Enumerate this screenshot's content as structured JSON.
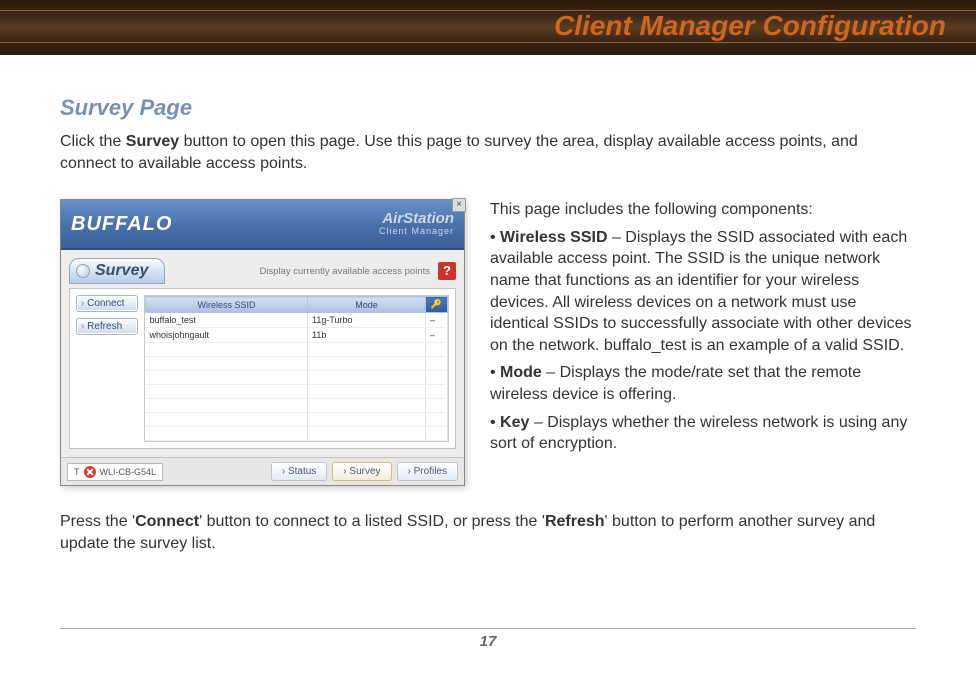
{
  "header": {
    "title": "Client Manager Configuration"
  },
  "section": {
    "title": "Survey Page",
    "intro_prefix": "Click the ",
    "intro_bold": "Survey",
    "intro_suffix": " button to open this page. Use this page to survey the area, display available access points, and connect to available access points."
  },
  "screenshot": {
    "brand": "BUFFALO",
    "title_main": "AirStation",
    "title_sub": "Client Manager",
    "close_x": "×",
    "tab_label": "Survey",
    "caption": "Display currently available access points",
    "help": "?",
    "buttons": {
      "connect": "Connect",
      "refresh": "Refresh"
    },
    "table": {
      "headers": {
        "ssid": "Wireless SSID",
        "mode": "Mode",
        "key_icon": "🔑"
      },
      "rows": [
        {
          "ssid": "buffalo_test",
          "mode": "11g-Turbo",
          "key": "–"
        },
        {
          "ssid": "whoisjohngault",
          "mode": "11b",
          "key": "–"
        }
      ]
    },
    "adapter": "WLI-CB-G54L",
    "footer_tabs": {
      "status": "Status",
      "survey": "Survey",
      "profiles": "Profiles"
    }
  },
  "components": {
    "intro": "This page includes the following components:",
    "ssid": {
      "label": "Wireless SSID",
      "text": " – Displays the SSID associated with each available access point. The SSID is the unique network name that functions as an identifier for your wireless devices. All wireless devices on a network must use identical SSIDs to successfully associate with other devices on the network. buffalo_test is an example of a valid SSID."
    },
    "mode": {
      "label": "Mode",
      "text": " – Displays the mode/rate set that the remote wireless device is offering."
    },
    "key": {
      "label": "Key",
      "text": " – Displays whether the wireless network is using any sort of encryption."
    }
  },
  "bottom": {
    "p1": "Press the '",
    "b1": "Connect",
    "p2": "' button to connect to a listed SSID, or press the '",
    "b2": "Refresh",
    "p3": "' button to perform another survey and update the survey list."
  },
  "page_number": "17"
}
